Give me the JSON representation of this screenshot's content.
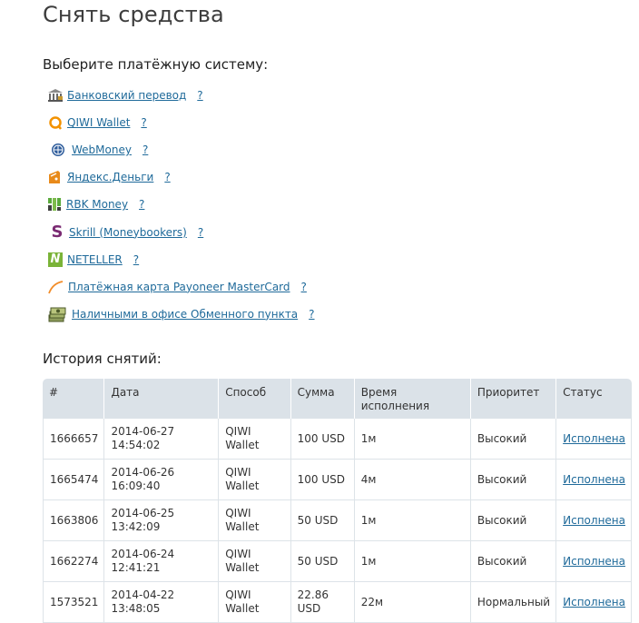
{
  "page": {
    "title": "Снять средства",
    "choose_label": "Выберите платёжную систему:",
    "history_label": "История снятий:"
  },
  "payment_methods": [
    {
      "label": "Банковский перевод",
      "help": "?",
      "icon": "bank-icon"
    },
    {
      "label": "QIWI Wallet",
      "help": "?",
      "icon": "qiwi-icon"
    },
    {
      "label": "WebMoney",
      "help": "?",
      "icon": "webmoney-icon"
    },
    {
      "label": "Яндекс.Деньги",
      "help": "?",
      "icon": "yandex-money-icon"
    },
    {
      "label": "RBK Money",
      "help": "?",
      "icon": "rbk-money-icon"
    },
    {
      "label": "Skrill (Moneybookers)",
      "help": "?",
      "icon": "skrill-icon"
    },
    {
      "label": "NETELLER",
      "help": "?",
      "icon": "neteller-icon"
    },
    {
      "label": "Платёжная карта Payoneer MasterCard",
      "help": "?",
      "icon": "payoneer-icon"
    },
    {
      "label": "Наличными в офисе Обменного пункта",
      "help": "?",
      "icon": "cash-icon"
    }
  ],
  "history": {
    "columns": [
      "#",
      "Дата",
      "Способ",
      "Сумма",
      "Время исполнения",
      "Приоритет",
      "Статус"
    ],
    "rows": [
      {
        "id": "1666657",
        "date": "2014-06-27",
        "time": "14:54:02",
        "method": "QIWI Wallet",
        "amount": "100 USD",
        "exec": "1м",
        "priority": "Высокий",
        "status": "Исполнена"
      },
      {
        "id": "1665474",
        "date": "2014-06-26",
        "time": "16:09:40",
        "method": "QIWI Wallet",
        "amount": "100 USD",
        "exec": "4м",
        "priority": "Высокий",
        "status": "Исполнена"
      },
      {
        "id": "1663806",
        "date": "2014-06-25",
        "time": "13:42:09",
        "method": "QIWI Wallet",
        "amount": "50 USD",
        "exec": "1м",
        "priority": "Высокий",
        "status": "Исполнена"
      },
      {
        "id": "1662274",
        "date": "2014-06-24",
        "time": "12:41:21",
        "method": "QIWI Wallet",
        "amount": "50 USD",
        "exec": "1м",
        "priority": "Высокий",
        "status": "Исполнена"
      },
      {
        "id": "1573521",
        "date": "2014-04-22",
        "time": "13:48:05",
        "method": "QIWI Wallet",
        "amount": "22.86 USD",
        "exec": "22м",
        "priority": "Нормальный",
        "status": "Исполнена"
      }
    ]
  },
  "colors": {
    "link": "#1f6a9a",
    "header_bg": "#dbe2e8",
    "border": "#dde3e8"
  }
}
